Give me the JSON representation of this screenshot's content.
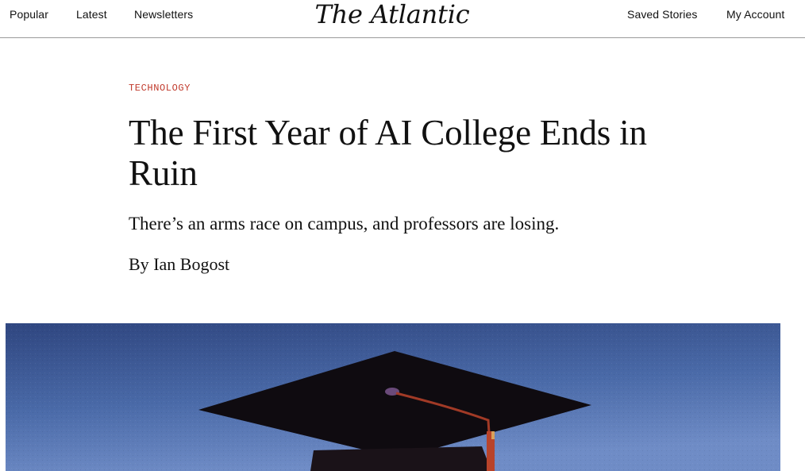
{
  "nav": {
    "left": [
      "Popular",
      "Latest",
      "Newsletters"
    ],
    "logo": "The Atlantic",
    "right": [
      "Saved Stories",
      "My Account"
    ]
  },
  "article": {
    "section": "TECHNOLOGY",
    "headline": "The First Year of AI College Ends in Ruin",
    "dek": "There’s an arms race on campus, and professors are losing.",
    "byline_prefix": "By",
    "author": "Ian Bogost"
  },
  "hero_image": {
    "subject": "graduation cap against blue sky",
    "colors": {
      "sky": "#4a6aa8",
      "sky_dark": "#2b3f73",
      "cap": "#0f0b10",
      "tassel": "#b8432a"
    }
  },
  "colors": {
    "section_tag": "#c0392b",
    "text": "#111111",
    "divider": "#9a9a9a"
  }
}
